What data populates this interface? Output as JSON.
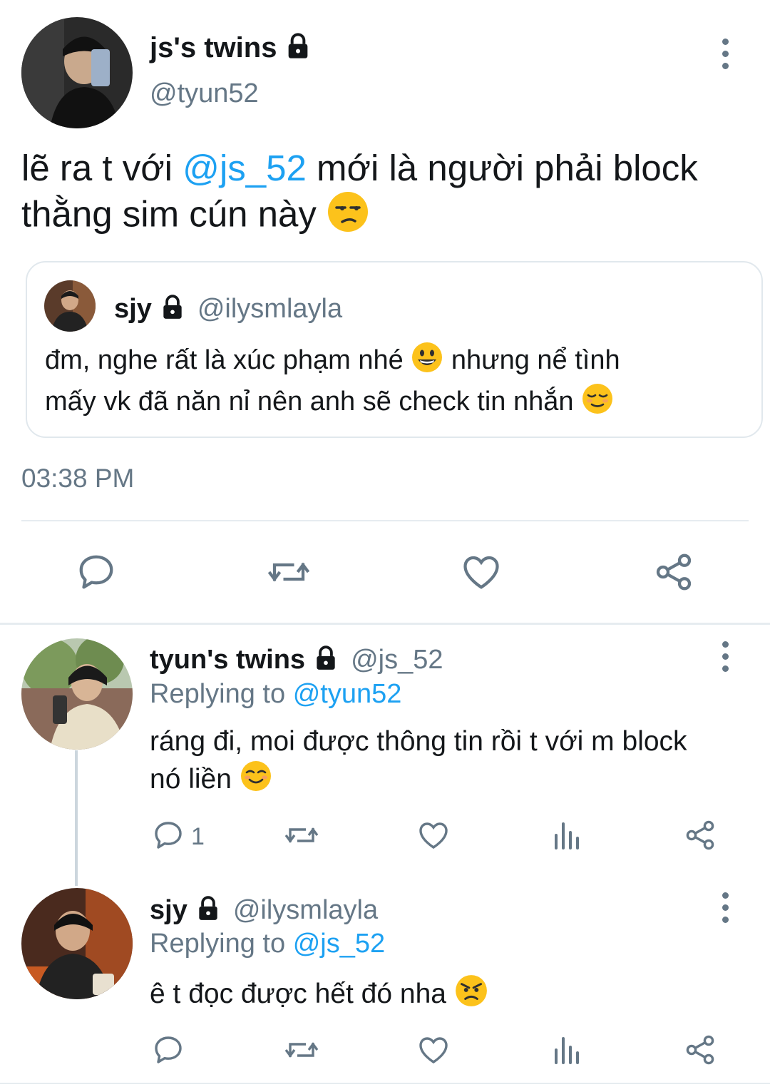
{
  "main_tweet": {
    "display_name": "js's twins",
    "handle": "@tyun52",
    "text_before": "lẽ ra t với ",
    "mention": "@js_52",
    "text_after": " mới là người phải block thằng sim cún này",
    "time": "03:38 PM"
  },
  "quoted_tweet": {
    "display_name": "sjy",
    "handle": "@ilysmlayla",
    "line1": "đm, nghe rất là xúc phạm nhé",
    "line1b": "nhưng nể tình",
    "line2": "mấy vk đã năn nỉ nên anh sẽ check tin nhắn"
  },
  "replies": [
    {
      "display_name": "tyun's twins",
      "handle": "@js_52",
      "replying_label": "Replying to",
      "replying_to": "@tyun52",
      "line1": "ráng đi, moi được thông tin rồi t với m block",
      "line2": "nó liền",
      "reply_count": "1"
    },
    {
      "display_name": "sjy",
      "handle": "@ilysmlayla",
      "replying_label": "Replying to",
      "replying_to": "@js_52",
      "line1": "ê t đọc được hết đó nha",
      "reply_count": ""
    }
  ],
  "icons": [
    "lock-icon",
    "more-icon",
    "reply-icon",
    "retweet-icon",
    "like-icon",
    "share-icon",
    "analytics-icon"
  ],
  "colors": {
    "accent": "#1da1f2",
    "muted": "#657786",
    "text": "#14171a",
    "divider": "#e6ecf0"
  }
}
